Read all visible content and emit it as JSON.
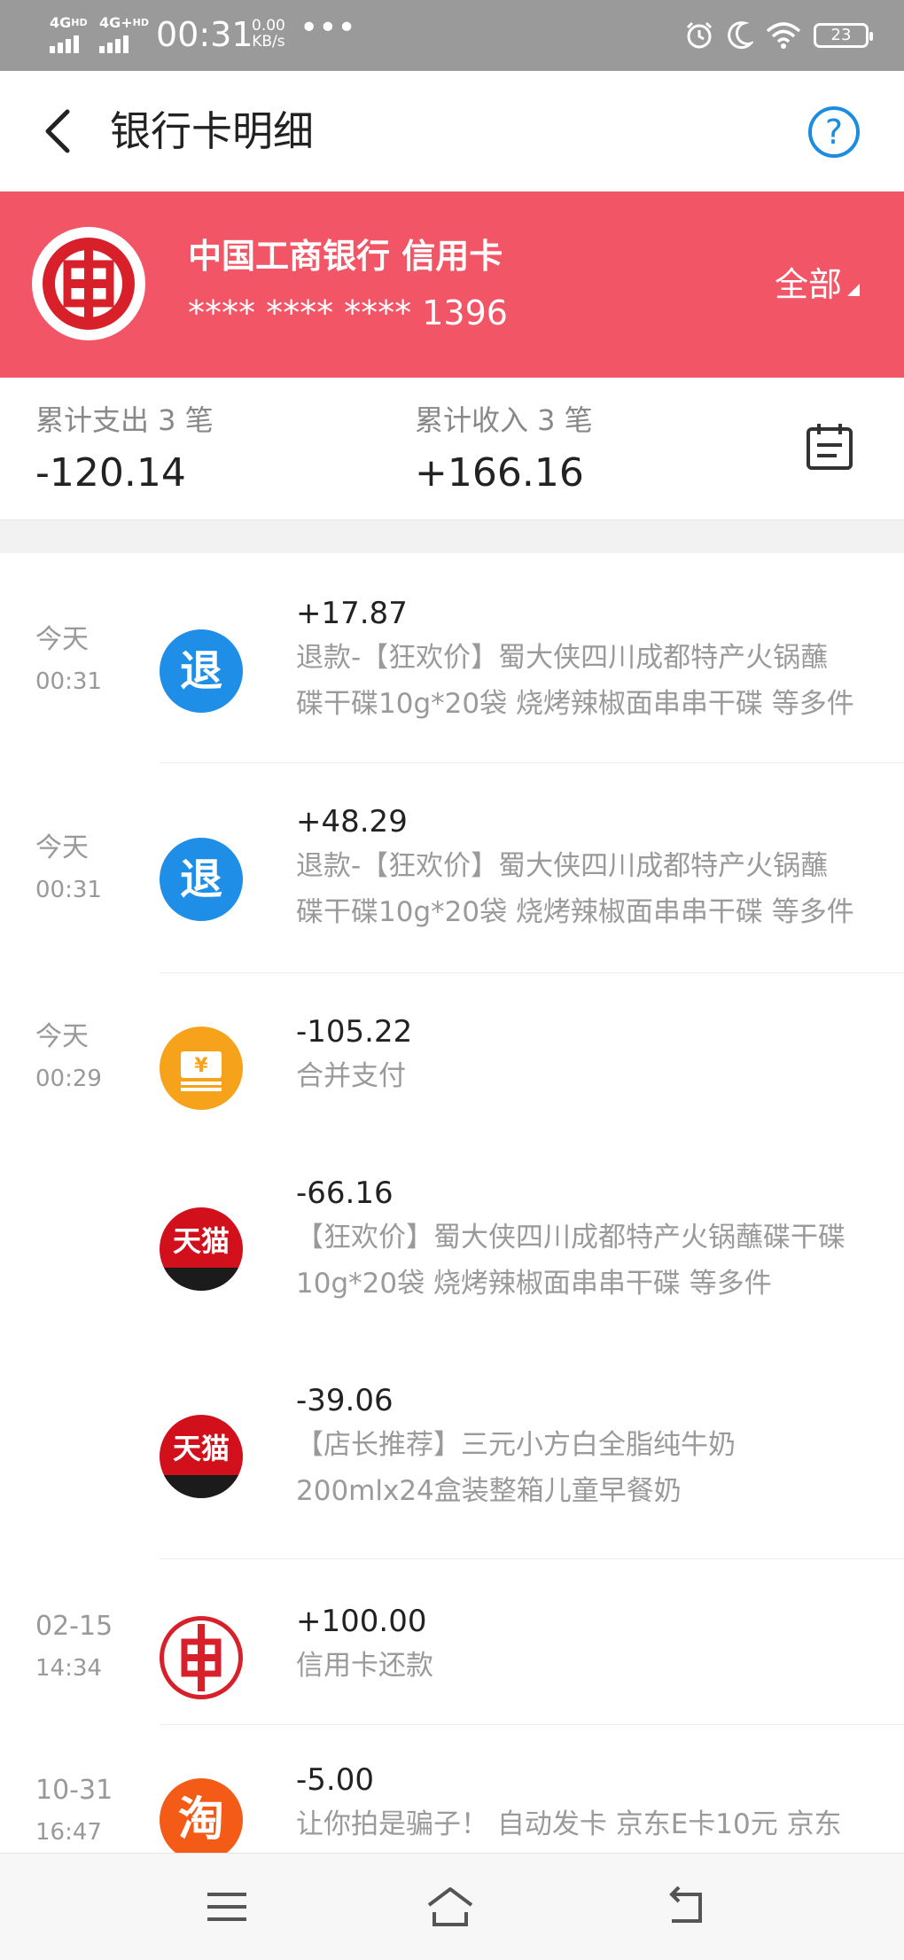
{
  "status_bar": {
    "signal1": "4G",
    "signal1_sup": "HD",
    "signal2": "4G+",
    "signal2_sup": "HD",
    "time": "00:31",
    "speed_value": "0.00",
    "speed_unit": "KB/s",
    "more": "•••",
    "battery": "23",
    "icons": [
      "alarm-icon",
      "moon-icon",
      "wifi-icon",
      "battery-icon"
    ]
  },
  "nav": {
    "title": "银行卡明细",
    "back_icon": "chevron-left-icon",
    "help_label": "?"
  },
  "card": {
    "bank_name": "中国工商银行 信用卡",
    "card_number": "**** **** **** 1396",
    "filter_label": "全部",
    "background_color": "#f25565"
  },
  "summary": {
    "expense_label": "累计支出 3 笔",
    "expense_value": "-120.14",
    "income_label": "累计收入 3 笔",
    "income_value": "+166.16"
  },
  "transactions": [
    {
      "date": "今天",
      "time": "00:31",
      "icon": "退",
      "icon_type": "refund-icon",
      "amount": "+17.87",
      "desc_line1": "退款-【狂欢价】蜀大侠四川成都特产火锅蘸",
      "desc_line2": "碟干碟10g*20袋 烧烤辣椒面串串干碟 等多件"
    },
    {
      "date": "今天",
      "time": "00:31",
      "icon": "退",
      "icon_type": "refund-icon",
      "amount": "+48.29",
      "desc_line1": "退款-【狂欢价】蜀大侠四川成都特产火锅蘸",
      "desc_line2": "碟干碟10g*20袋 烧烤辣椒面串串干碟 等多件"
    },
    {
      "date": "今天",
      "time": "00:29",
      "icon": "¥",
      "icon_type": "merge-pay-icon",
      "amount": "-105.22",
      "desc_line1": "合并支付",
      "desc_line2": ""
    },
    {
      "date": "",
      "time": "",
      "icon": "天猫",
      "icon_type": "tmall-icon",
      "amount": "-66.16",
      "desc_line1": "【狂欢价】蜀大侠四川成都特产火锅蘸碟干碟",
      "desc_line2": "10g*20袋 烧烤辣椒面串串干碟 等多件"
    },
    {
      "date": "",
      "time": "",
      "icon": "天猫",
      "icon_type": "tmall-icon",
      "amount": "-39.06",
      "desc_line1": "【店长推荐】三元小方白全脂纯牛奶",
      "desc_line2": "200mlx24盒装整箱儿童早餐奶"
    },
    {
      "date": "02-15",
      "time": "14:34",
      "icon": "",
      "icon_type": "icbc-icon",
      "amount": "+100.00",
      "desc_line1": "信用卡还款",
      "desc_line2": ""
    },
    {
      "date": "10-31",
      "time": "16:47",
      "icon": "淘",
      "icon_type": "taobao-icon",
      "amount": "-5.00",
      "desc_line1": "让你拍是骗子！ 自动发卡 京东E卡10元 京东",
      "desc_line2": ""
    }
  ],
  "bottom_nav": {
    "menu_icon": "menu-icon",
    "home_icon": "home-icon",
    "back_icon": "back-icon"
  }
}
